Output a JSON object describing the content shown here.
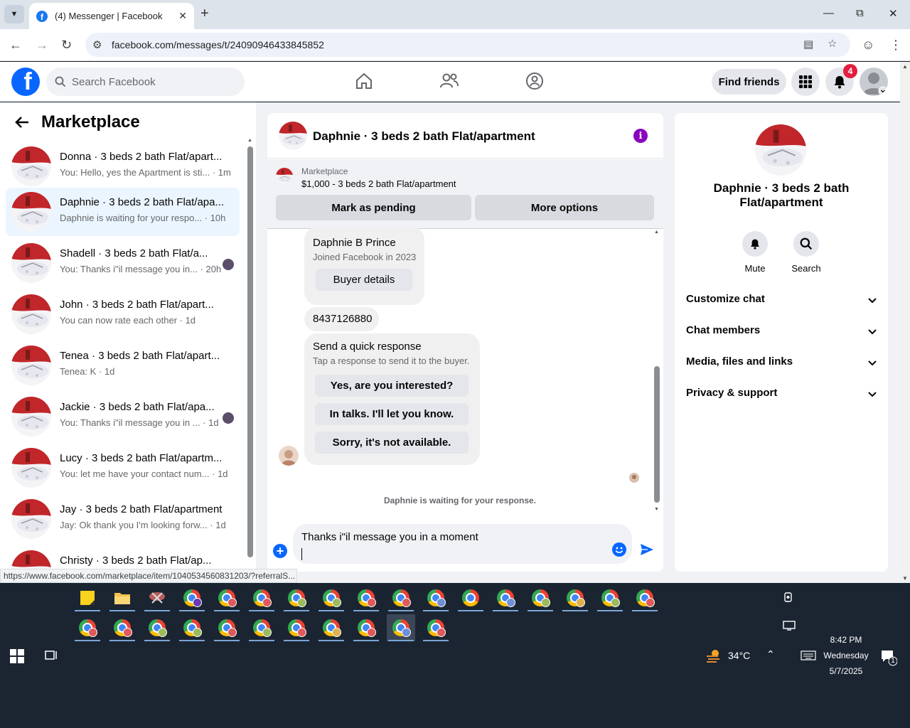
{
  "browser": {
    "tab_title": "(4) Messenger | Facebook",
    "url": "facebook.com/messages/t/24090946433845852",
    "status_url": "https://www.facebook.com/marketplace/item/1040534560831203/?referralS..."
  },
  "fb_header": {
    "search_placeholder": "Search Facebook",
    "find_friends": "Find friends",
    "notification_count": "4"
  },
  "left_panel": {
    "title": "Marketplace",
    "conversations": [
      {
        "name": "Donna · 3 beds 2 bath Flat/apart...",
        "preview": "You: Hello, yes the Apartment is sti... · 1m"
      },
      {
        "name": "Daphnie · 3 beds 2 bath Flat/apa...",
        "preview": "Daphnie is waiting for your respo... · 10h"
      },
      {
        "name": "Shadell · 3 beds 2 bath Flat/a...",
        "preview": "You: Thanks i\"il message you in... · 20h"
      },
      {
        "name": "John · 3 beds 2 bath Flat/apart...",
        "preview": "You can now rate each other · 1d"
      },
      {
        "name": "Tenea · 3 beds 2 bath Flat/apart...",
        "preview": "Tenea: K · 1d"
      },
      {
        "name": "Jackie · 3 beds 2 bath Flat/apa...",
        "preview": "You: Thanks i\"il message you in ... · 1d"
      },
      {
        "name": "Lucy · 3 beds 2 bath Flat/apartm...",
        "preview": "You: let me have your contact num... · 1d"
      },
      {
        "name": "Jay · 3 beds 2 bath Flat/apartment",
        "preview": "Jay: Ok thank you I'm looking forw... · 1d"
      },
      {
        "name": "Christy · 3 beds 2 bath Flat/ap...",
        "preview": ""
      }
    ]
  },
  "chat": {
    "title": "Daphnie · 3 beds 2 bath Flat/apartment",
    "listing_category": "Marketplace",
    "listing_price": "$1,000 - 3 beds 2 bath Flat/apartment",
    "mark_pending": "Mark as pending",
    "more_options": "More options",
    "buyer_name": "Daphnie B Prince",
    "buyer_joined": "Joined Facebook in 2023",
    "buyer_details": "Buyer details",
    "phone": "8437126880",
    "quick_title": "Send a quick response",
    "quick_sub": "Tap a response to send it to the buyer.",
    "quick_responses": [
      "Yes, are you interested?",
      "In talks. I'll let you know.",
      "Sorry, it's not available."
    ],
    "waiting": "Daphnie is waiting for your response.",
    "draft": "Thanks i\"il message you in a moment"
  },
  "right_panel": {
    "name": "Daphnie · 3 beds 2 bath Flat/apartment",
    "mute": "Mute",
    "search": "Search",
    "sections": [
      "Customize chat",
      "Chat members",
      "Media, files and links",
      "Privacy & support"
    ]
  },
  "taskbar": {
    "temperature": "34°C",
    "time": "8:42 PM",
    "day": "Wednesday",
    "date": "5/7/2025",
    "notification_count": "1"
  },
  "colors": {
    "fb_blue": "#0866ff",
    "active_conv": "#ebf5ff",
    "notif_red": "#e41e3f",
    "info_purple": "#8a05be",
    "taskbar": "#1b2532"
  }
}
